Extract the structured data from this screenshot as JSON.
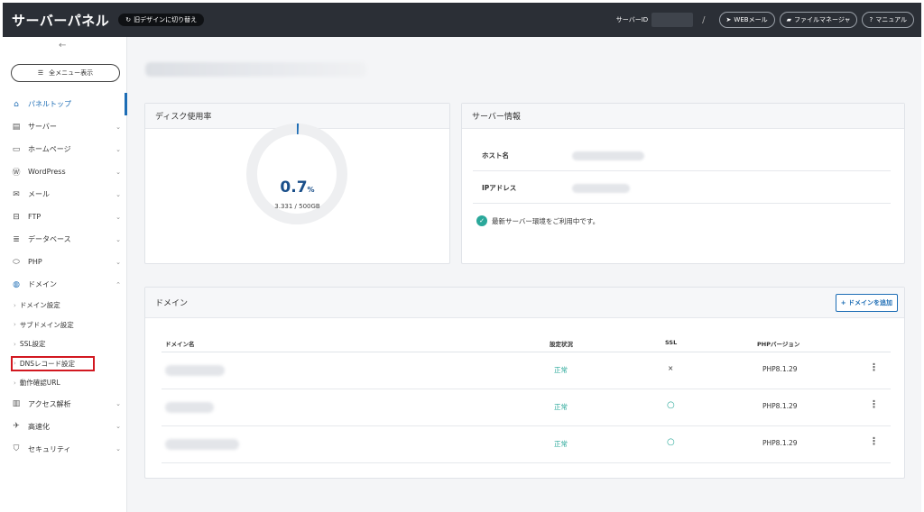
{
  "header": {
    "brand": "サーバーパネル",
    "old_design": "旧デザインに切り替え",
    "server_id_label": "サーバーID",
    "links": [
      {
        "icon": "send-icon",
        "label": "WEBメール"
      },
      {
        "icon": "folder-icon",
        "label": "ファイルマネージャ"
      },
      {
        "icon": "help-icon",
        "label": "マニュアル"
      }
    ]
  },
  "sidebar": {
    "menu_button": "全メニュー表示",
    "items": [
      {
        "icon": "home-icon",
        "label": "パネルトップ"
      },
      {
        "icon": "server-icon",
        "label": "サーバー"
      },
      {
        "icon": "browser-icon",
        "label": "ホームページ"
      },
      {
        "icon": "wordpress-icon",
        "label": "WordPress"
      },
      {
        "icon": "mail-icon",
        "label": "メール"
      },
      {
        "icon": "monitor-icon",
        "label": "FTP"
      },
      {
        "icon": "database-icon",
        "label": "データベース"
      },
      {
        "icon": "php-icon",
        "label": "PHP"
      },
      {
        "icon": "globe-icon",
        "label": "ドメイン"
      }
    ],
    "domain_sub": [
      "ドメイン設定",
      "サブドメイン設定",
      "SSL設定",
      "DNSレコード設定",
      "動作確認URL"
    ],
    "items_after": [
      {
        "icon": "chart-icon",
        "label": "アクセス解析"
      },
      {
        "icon": "rocket-icon",
        "label": "高速化"
      },
      {
        "icon": "shield-icon",
        "label": "セキュリティ"
      }
    ]
  },
  "disk": {
    "title": "ディスク使用率",
    "percent": "0.7",
    "percent_unit": "%",
    "usage": "3.331 / 500GB",
    "fraction": 0.007
  },
  "server": {
    "title": "サーバー情報",
    "host_label": "ホスト名",
    "ip_label": "IPアドレス",
    "status": "最新サーバー環境をご利用中です。"
  },
  "domain": {
    "title": "ドメイン",
    "add_button": "+ ドメインを追加",
    "columns": {
      "name": "ドメイン名",
      "status": "設定状況",
      "ssl": "SSL",
      "php": "PHPバージョン"
    },
    "rows": [
      {
        "status": "正常",
        "ssl": "×",
        "php": "PHP8.1.29"
      },
      {
        "status": "正常",
        "ssl": "○",
        "php": "PHP8.1.29"
      },
      {
        "status": "正常",
        "ssl": "○",
        "php": "PHP8.1.29"
      }
    ]
  },
  "colors": {
    "accent": "#1d6db5",
    "ok": "#2aa89a",
    "header": "#2b2f36",
    "highlight": "#d21820"
  }
}
